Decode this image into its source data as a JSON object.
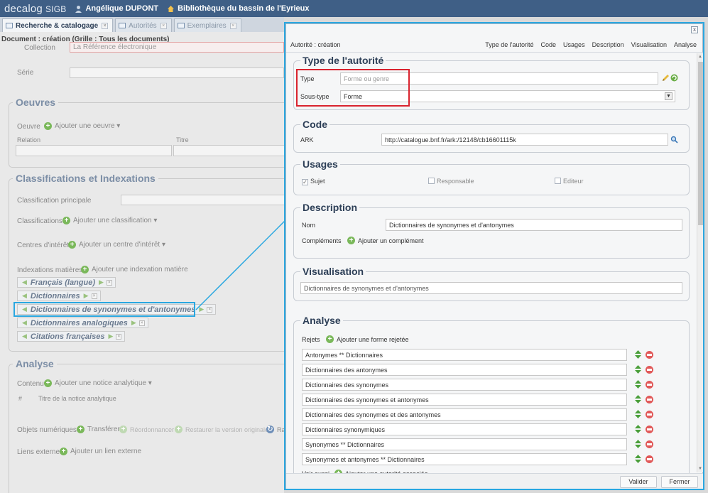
{
  "topbar": {
    "brand": "decalog",
    "brand_sub": "SIGB",
    "user": "Angélique DUPONT",
    "library": "Bibliothèque du bassin de l'Eyrieux"
  },
  "tabs": [
    {
      "label": "Recherche & catalogage"
    },
    {
      "label": "Autorités"
    },
    {
      "label": "Exemplaires"
    }
  ],
  "left": {
    "doc_title": "Document : création (Grille : Tous les documents)",
    "collection_label": "Collection",
    "collection_value": "La Référence électronique",
    "serie_label": "Série",
    "oeuvres_legend": "Oeuvres",
    "oeuvre_label": "Oeuvre",
    "add_oeuvre": "Ajouter une oeuvre",
    "col_relation": "Relation",
    "col_titre": "Titre",
    "classif_legend": "Classifications et Indexations",
    "classif_principale": "Classification principale",
    "classifications": "Classifications",
    "add_classification": "Ajouter une classification",
    "centres": "Centres d'intérêt",
    "add_centre": "Ajouter un centre d'intérêt",
    "indexations": "Indexations matières",
    "add_indexation": "Ajouter une indexation matière",
    "tags": [
      "Français (langue)",
      "Dictionnaires",
      "Dictionnaires de synonymes et d'antonymes",
      "Dictionnaires analogiques",
      "Citations françaises"
    ],
    "analyse_legend": "Analyse",
    "contenu": "Contenu",
    "add_notice": "Ajouter une notice analytique",
    "hash": "#",
    "titre_notice": "Titre de la notice analytique",
    "objets": "Objets numériques",
    "transferer": "Transférer",
    "reordonner": "Réordonnancer",
    "restaurer": "Restaurer la version originale",
    "raf": "Raf",
    "liens": "Liens externes",
    "add_lien": "Ajouter un lien externe"
  },
  "modal": {
    "title": "Autorité : création",
    "close": "x",
    "nav": [
      "Type de l'autorité",
      "Code",
      "Usages",
      "Description",
      "Visualisation",
      "Analyse"
    ],
    "type_legend": "Type de l'autorité",
    "type_label": "Type",
    "type_placeholder": "Forme ou genre",
    "soustype_label": "Sous-type",
    "soustype_value": "Forme",
    "code_legend": "Code",
    "ark_label": "ARK",
    "ark_value": "http://catalogue.bnf.fr/ark:/12148/cb16601115k",
    "usages_legend": "Usages",
    "usages": [
      {
        "label": "Sujet",
        "checked": true
      },
      {
        "label": "Responsable",
        "checked": false
      },
      {
        "label": "Editeur",
        "checked": false
      }
    ],
    "description_legend": "Description",
    "nom_label": "Nom",
    "nom_value": "Dictionnaires de synonymes et d'antonymes",
    "complements": "Compléments",
    "add_complement": "Ajouter un complément",
    "visualisation_legend": "Visualisation",
    "visualisation_value": "Dictionnaires de synonymes et d'antonymes",
    "analyse_legend": "Analyse",
    "rejets": "Rejets",
    "add_rejet": "Ajouter une forme rejetée",
    "rejets_list": [
      "Antonymes ** Dictionnaires",
      "Dictionnaires des antonymes",
      "Dictionnaires des synonymes",
      "Dictionnaires des synonymes et antonymes",
      "Dictionnaires des synonymes et des antonymes",
      "Dictionnaires synonymiques",
      "Synonymes ** Dictionnaires",
      "Synonymes et antonymes ** Dictionnaires"
    ],
    "voir_aussi": "Voir aussi",
    "add_associee": "Ajouter une autorité associée",
    "valider": "Valider",
    "fermer": "Fermer"
  }
}
